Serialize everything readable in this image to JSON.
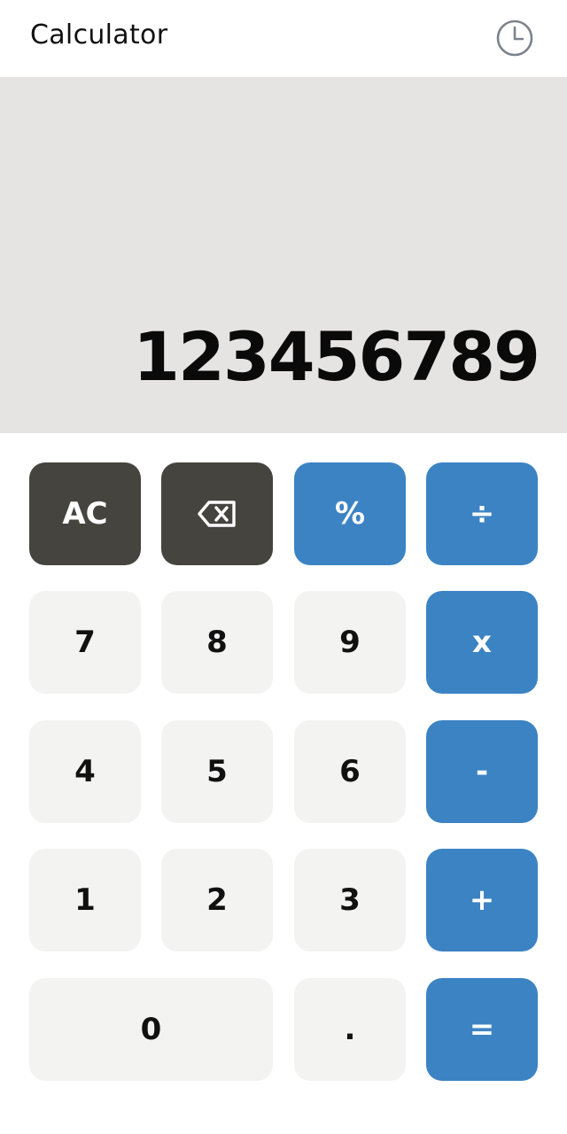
{
  "header": {
    "title": "Calculator",
    "history_icon": "clock-icon"
  },
  "display": {
    "value": "123456789"
  },
  "keys": {
    "clear": "AC",
    "backspace_icon": "backspace-icon",
    "percent": "%",
    "divide": "÷",
    "seven": "7",
    "eight": "8",
    "nine": "9",
    "multiply": "x",
    "four": "4",
    "five": "5",
    "six": "6",
    "subtract": "-",
    "one": "1",
    "two": "2",
    "three": "3",
    "add": "+",
    "zero": "0",
    "decimal": ".",
    "equals": "="
  },
  "colors": {
    "display_bg": "#e5e4e2",
    "number_key": "#f3f3f2",
    "function_key": "#46443f",
    "operator_key": "#3c83c4"
  }
}
